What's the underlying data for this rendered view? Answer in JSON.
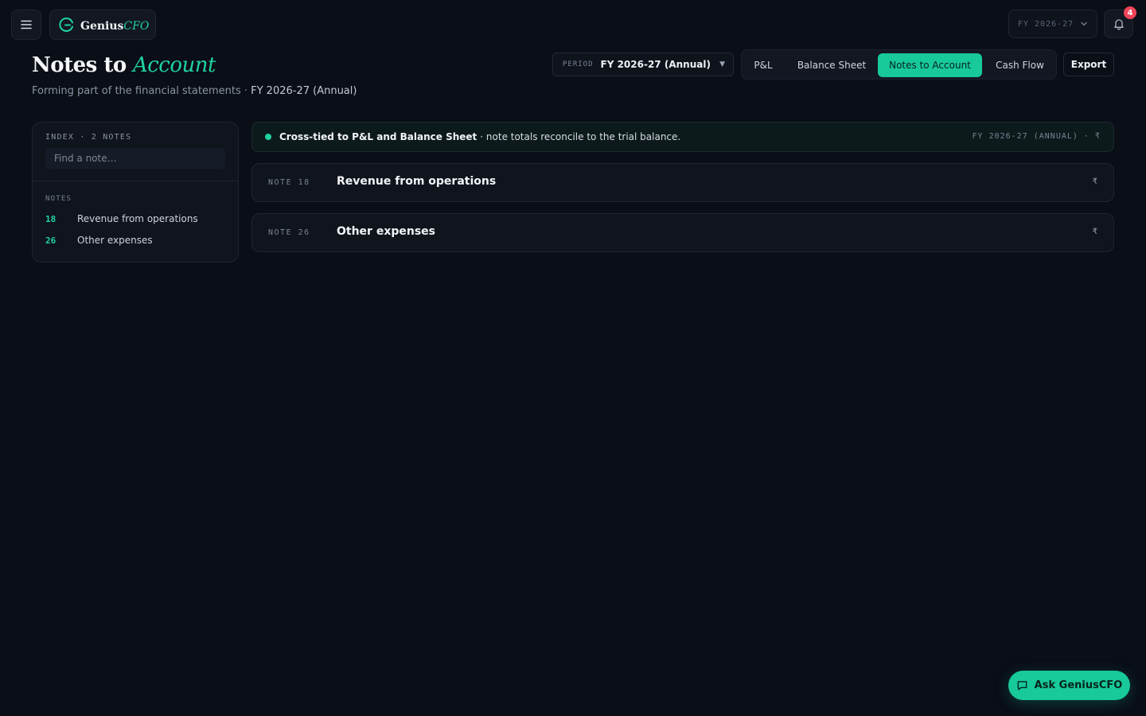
{
  "brand": {
    "name": "Genius",
    "accent": "CFO"
  },
  "topbar": {
    "fy_selector": "FY 2026-27",
    "notification_count": "4"
  },
  "header": {
    "title_main": "Notes to",
    "title_accent": "Account",
    "subtitle_lead": "Forming part of the financial statements ·",
    "subtitle_period": "FY 2026-27 (Annual)"
  },
  "period": {
    "label": "PERIOD",
    "value": "FY 2026-27 (Annual)",
    "caret": "▼"
  },
  "tabs": [
    {
      "label": "P&L",
      "active": false
    },
    {
      "label": "Balance Sheet",
      "active": false
    },
    {
      "label": "Notes to Account",
      "active": true
    },
    {
      "label": "Cash Flow",
      "active": false
    }
  ],
  "export_label": "Export",
  "sidebar": {
    "index_label": "INDEX · 2 NOTES",
    "search_placeholder": "Find a note…",
    "notes_label": "NOTES",
    "items": [
      {
        "number": "18",
        "name": "Revenue from operations"
      },
      {
        "number": "26",
        "name": "Other expenses"
      }
    ]
  },
  "banner": {
    "strong": "Cross-tied to P&L and Balance Sheet",
    "rest": "· note totals reconcile to the trial balance.",
    "meta": "FY 2026-27 (ANNUAL) · ₹"
  },
  "notes": [
    {
      "tag": "NOTE 18",
      "title": "Revenue from operations",
      "currency": "₹"
    },
    {
      "tag": "NOTE 26",
      "title": "Other expenses",
      "currency": "₹"
    }
  ],
  "ask_label": "Ask GeniusCFO",
  "colors": {
    "background": "#0a0e16",
    "accent": "#1fd3a0",
    "badge": "#f0445a"
  }
}
